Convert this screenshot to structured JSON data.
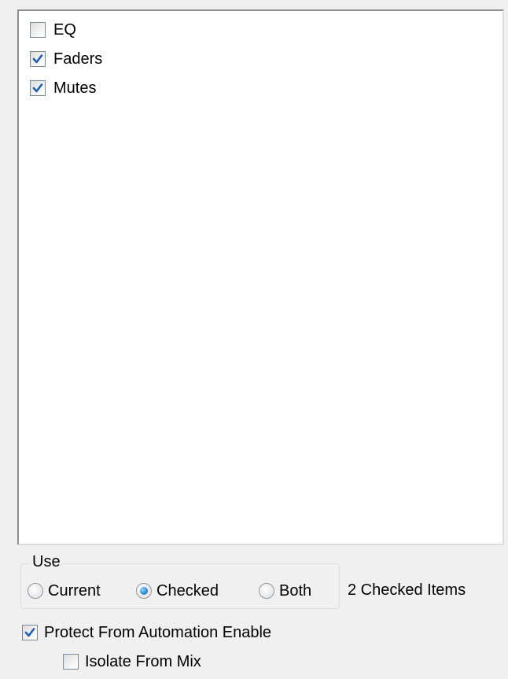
{
  "list": {
    "items": [
      {
        "label": "EQ",
        "checked": false
      },
      {
        "label": "Faders",
        "checked": true
      },
      {
        "label": "Mutes",
        "checked": true
      }
    ]
  },
  "use_group": {
    "legend": "Use",
    "options": [
      {
        "label": "Current",
        "selected": false
      },
      {
        "label": "Checked",
        "selected": true
      },
      {
        "label": "Both",
        "selected": false
      }
    ]
  },
  "status": {
    "checked_count": "2 Checked Items"
  },
  "options": {
    "protect_label": "Protect From Automation Enable",
    "protect_checked": true,
    "isolate_label": "Isolate From Mix",
    "isolate_checked": false
  },
  "colors": {
    "window_bg": "#f0f0f0",
    "list_bg": "#ffffff",
    "check_mark": "#1f5fb0",
    "radio_dot": "#2f8fd8"
  }
}
